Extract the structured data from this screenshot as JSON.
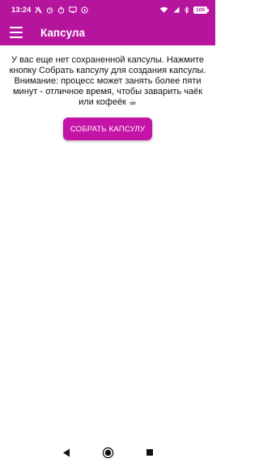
{
  "status_bar": {
    "time": "13:24",
    "battery": "100",
    "icons": [
      "vpn-icon",
      "alarm-icon",
      "timer-icon",
      "screen-icon",
      "navigation-icon",
      "wifi-icon",
      "signal-icon",
      "bluetooth-icon",
      "battery-icon"
    ]
  },
  "app_bar": {
    "title": "Капсула",
    "menu_icon": "hamburger-menu-icon"
  },
  "main": {
    "message": "У вас еще нет сохраненной капсулы. Нажмите кнопку Собрать капсулу для создания капсулы. Внимание: процесс может занять более пяти минут - отличное время, чтобы заварить чаёк или кофеёк ☕",
    "collect_button_label": "СОБРАТЬ КАПСУЛУ"
  },
  "nav_bar": {
    "icons": [
      "back-icon",
      "home-icon",
      "recents-icon"
    ]
  },
  "colors": {
    "primary": "#b5159d",
    "button": "#c414a8"
  }
}
